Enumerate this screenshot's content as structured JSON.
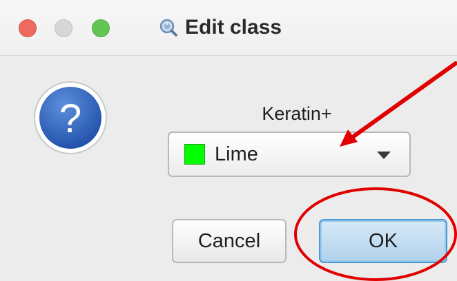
{
  "window": {
    "title": "Edit class"
  },
  "dialog": {
    "class_name": "Keratin+",
    "color_select": {
      "selected_label": "Lime",
      "selected_color": "#00ff00"
    },
    "buttons": {
      "cancel_label": "Cancel",
      "ok_label": "OK"
    }
  },
  "annotations": {
    "arrow_color": "#e00000",
    "circle_color": "#e00000"
  },
  "icons": {
    "app": "magnifier-app-icon",
    "dialog": "question-icon",
    "dropdown": "chevron-down-icon"
  }
}
